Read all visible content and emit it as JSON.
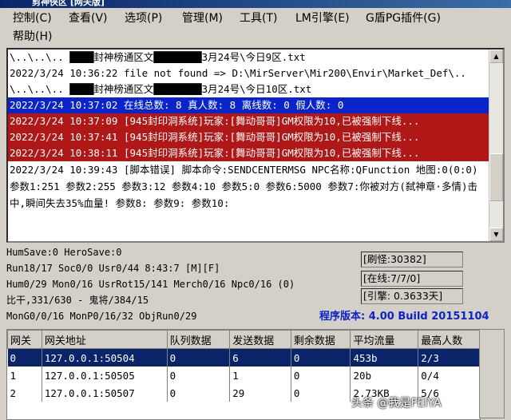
{
  "window": {
    "title": "剪神侠区 [网关版]"
  },
  "menu": [
    {
      "label": "控制(C)"
    },
    {
      "label": "查看(V)"
    },
    {
      "label": "选项(P)"
    },
    {
      "label": "管理(M)"
    },
    {
      "label": "工具(T)"
    },
    {
      "label": "LM引擎(E)"
    },
    {
      "label": "G盾PG插件(G)"
    },
    {
      "label": "帮助(H)"
    }
  ],
  "log": {
    "lines": [
      {
        "text": "\\..\\..\\.. ████封神榜通区文████████3月24号\\今日9区.txt",
        "style": "normal"
      },
      {
        "text": "2022/3/24 10:36:22 file not found => D:\\MirServer\\Mir200\\Envir\\Market_Def\\..",
        "style": "normal"
      },
      {
        "text": "\\..\\..\\.. ████封神榜通区文████████3月24号\\今日10区.txt",
        "style": "normal"
      },
      {
        "text": "2022/3/24 10:37:02 在线总数: 8 真人数: 8 离线数: 0 假人数: 0",
        "style": "blue"
      },
      {
        "text": "2022/3/24 10:37:09 [945封印洞系统]玩家:[舞动哥哥]GM权限为10,已被强制下线...",
        "style": "red"
      },
      {
        "text": "2022/3/24 10:37:41 [945封印洞系统]玩家:[舞动哥哥]GM权限为10,已被强制下线...",
        "style": "red"
      },
      {
        "text": "2022/3/24 10:38:11 [945封印洞系统]玩家:[舞动哥哥]GM权限为10,已被强制下线...",
        "style": "red"
      },
      {
        "text": "2022/3/24 10:39:43 [脚本错误] 脚本命令:SENDCENTERMSG NPC名称:QFunction 地图:0(0:0) 参数1:251 参数2:255 参数3:12 参数4:10 参数5:0 参数6:5000 参数7:你被对方(弑神章·多情)击中,瞬间失去35%血量! 参数8: 参数9: 参数10:",
        "style": "wrap"
      }
    ]
  },
  "stats": {
    "line1": "HumSave:0 HeroSave:0",
    "line2": "Run18/17 Soc0/0 Usr0/44              8:43:7 [M][F]",
    "line3": "Hum0/29 Mon0/16 UsrRot15/141 Merch0/16 Npc0/16 (0)",
    "line4": "比干,331/630 - 鬼将/384/15",
    "line5": "MonG0/0/16 MonP0/16/32 ObjRun0/29"
  },
  "status_boxes": {
    "refresh": "[刷怪:30382]",
    "online": "[在线:7/7/0]",
    "engine": "[引擎: 0.3633天]"
  },
  "version": "程序版本: 4.00 Build 20151104",
  "gateway_table": {
    "headers": [
      "网关",
      "网关地址",
      "队列数据",
      "发送数据",
      "剩余数据",
      "平均流量",
      "最高人数"
    ],
    "rows": [
      [
        "0",
        "127.0.0.1:50504",
        "0",
        "6",
        "0",
        "453b",
        "2/3"
      ],
      [
        "1",
        "127.0.0.1:50505",
        "0",
        "1",
        "0",
        "20b",
        "0/4"
      ],
      [
        "2",
        "127.0.0.1:50507",
        "0",
        "29",
        "0",
        "2.73KB",
        "5/6"
      ]
    ]
  },
  "watermark": "头条 @我是FEIYA"
}
